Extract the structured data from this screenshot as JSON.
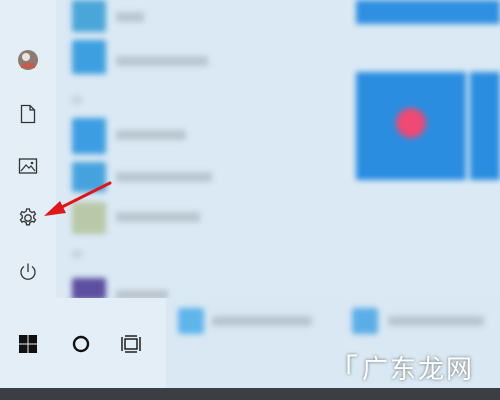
{
  "rail": {
    "items": [
      {
        "name": "user-account",
        "icon": "user-avatar-icon"
      },
      {
        "name": "documents",
        "icon": "document-icon"
      },
      {
        "name": "pictures",
        "icon": "pictures-icon"
      },
      {
        "name": "settings",
        "icon": "gear-icon"
      },
      {
        "name": "power",
        "icon": "power-icon"
      }
    ]
  },
  "taskbar": {
    "items": [
      {
        "name": "start",
        "icon": "windows-logo-icon"
      },
      {
        "name": "search",
        "icon": "cortana-circle-icon"
      },
      {
        "name": "task-view",
        "icon": "task-view-icon"
      }
    ]
  },
  "annotation": {
    "type": "arrow",
    "color": "#e0161b",
    "target": "settings"
  },
  "watermark": {
    "text": "广东龙网"
  },
  "colors": {
    "accent": "#1a86d6",
    "tile_blue": "#2f8fe0",
    "tile_pink": "#ee4a73",
    "rail_bg": "#e3eef7",
    "taskbar_dark": "#3b3f44"
  }
}
